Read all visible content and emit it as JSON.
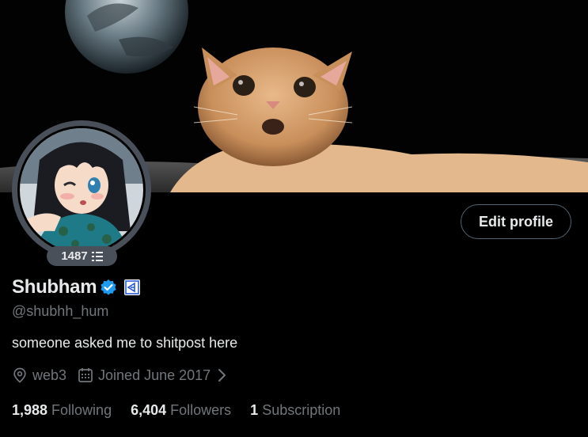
{
  "profile": {
    "display_name": "Shubham",
    "handle": "@shubhh_hum",
    "bio": "someone asked me to shitpost here",
    "badge_count": "1487",
    "edit_profile_label": "Edit profile",
    "verified_color": "#1d9bf0"
  },
  "meta": {
    "location": "web3",
    "joined": "Joined June 2017"
  },
  "stats": {
    "following_count": "1,988",
    "following_label": "Following",
    "followers_count": "6,404",
    "followers_label": "Followers",
    "subscriptions_count": "1",
    "subscriptions_label": "Subscription"
  },
  "icons": {
    "verified": "verified-check-icon",
    "affiliate": "affiliate-badge-icon",
    "location": "location-pin-icon",
    "calendar": "calendar-icon",
    "chevron": "chevron-right-icon",
    "badge": "stack-icon"
  }
}
